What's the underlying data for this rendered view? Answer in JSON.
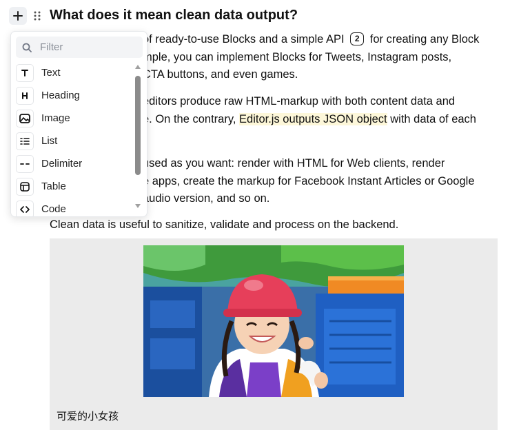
{
  "heading": "What does it mean clean data output?",
  "paragraphs": {
    "p1_line1_a": "of ready-to-use Blocks and a simple API",
    "p1_badge": "2",
    "p1_line1_b": "for creating any Block",
    "p1_line2": "mple, you can implement Blocks for Tweets, Instagram posts,",
    "p1_line3": "CTA buttons, and even games.",
    "p2_line1": "editors produce raw HTML-markup with both content data and",
    "p2_line2_a": "e. On the contrary,",
    "p2_highlight": "Editor.js outputs JSON object",
    "p2_line2_b": "with data of each",
    "p3_line1": "used as you want: render with HTML for Web clients, render",
    "p3_line2": "e apps, create the markup for Facebook Instant Articles or Google",
    "p3_line3": "audio version, and so on.",
    "p4": "Clean data is useful to sanitize, validate and process on the backend."
  },
  "image_caption": "可爱的小女孩",
  "toolbox": {
    "filter_placeholder": "Filter",
    "items": [
      {
        "label": "Text",
        "icon": "text-icon"
      },
      {
        "label": "Heading",
        "icon": "heading-icon"
      },
      {
        "label": "Image",
        "icon": "image-icon"
      },
      {
        "label": "List",
        "icon": "list-icon"
      },
      {
        "label": "Delimiter",
        "icon": "delimiter-icon"
      },
      {
        "label": "Table",
        "icon": "table-icon"
      },
      {
        "label": "Code",
        "icon": "code-icon"
      }
    ]
  },
  "colors": {
    "highlight": "#fdf7d9",
    "image_block_bg": "#ebebeb",
    "plus_button_bg": "#eef0f3"
  }
}
